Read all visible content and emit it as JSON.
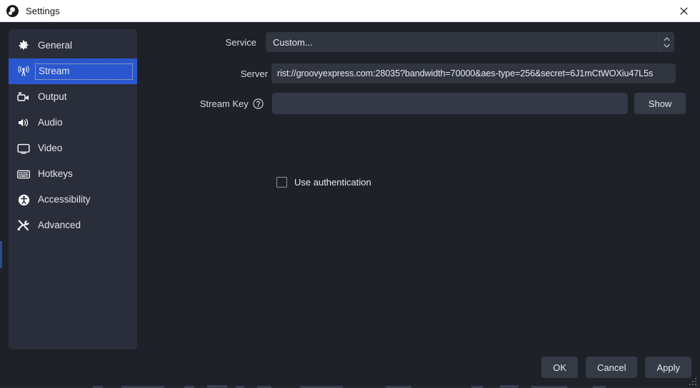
{
  "window": {
    "title": "Settings",
    "logo_icon": "obs-logo-icon",
    "close_icon": "close-icon",
    "background_color": "#1e2128",
    "titlebar_color": "#ffffff"
  },
  "sidebar": {
    "background_color": "#2a2e3a",
    "selected_color": "#2a57cf",
    "items": [
      {
        "label": "General",
        "icon": "gear-icon",
        "selected": false
      },
      {
        "label": "Stream",
        "icon": "broadcast-icon",
        "selected": true
      },
      {
        "label": "Output",
        "icon": "video-camera-icon",
        "selected": false
      },
      {
        "label": "Audio",
        "icon": "speaker-icon",
        "selected": false
      },
      {
        "label": "Video",
        "icon": "monitor-icon",
        "selected": false
      },
      {
        "label": "Hotkeys",
        "icon": "keyboard-icon",
        "selected": false
      },
      {
        "label": "Accessibility",
        "icon": "accessibility-icon",
        "selected": false
      },
      {
        "label": "Advanced",
        "icon": "tools-icon",
        "selected": false
      }
    ]
  },
  "form": {
    "service": {
      "label": "Service",
      "value": "Custom...",
      "arrows_icon": "chevron-up-down-icon"
    },
    "server": {
      "label": "Server",
      "value": "rist://groovyexpress.com:28035?bandwidth=70000&aes-type=256&secret=6J1mCtWOXiu47L5s",
      "placeholder": ""
    },
    "stream_key": {
      "label": "Stream Key",
      "help_icon": "help-circle-icon",
      "value": "",
      "placeholder": "",
      "show_button": "Show"
    },
    "use_authentication": {
      "label": "Use authentication",
      "checked": false
    }
  },
  "footer": {
    "ok": "OK",
    "cancel": "Cancel",
    "apply": "Apply",
    "resize_grip_icon": "resize-grip-icon"
  }
}
